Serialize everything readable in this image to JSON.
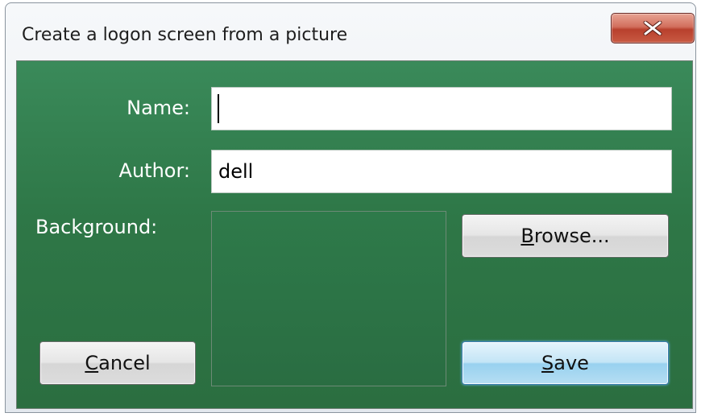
{
  "window": {
    "title": "Create a logon screen from a picture",
    "close_icon": "close-x-icon"
  },
  "form": {
    "name_label": "Name:",
    "name_value": "",
    "author_label": "Author:",
    "author_value": "dell",
    "background_label": "Background:"
  },
  "buttons": {
    "browse_mnemonic": "B",
    "browse_rest": "rowse...",
    "cancel_mnemonic": "C",
    "cancel_rest": "ancel",
    "save_mnemonic": "S",
    "save_rest": "ave"
  },
  "colors": {
    "client_background": "#2e7747",
    "close_button": "#c85a43",
    "default_button": "#98d1ef"
  }
}
